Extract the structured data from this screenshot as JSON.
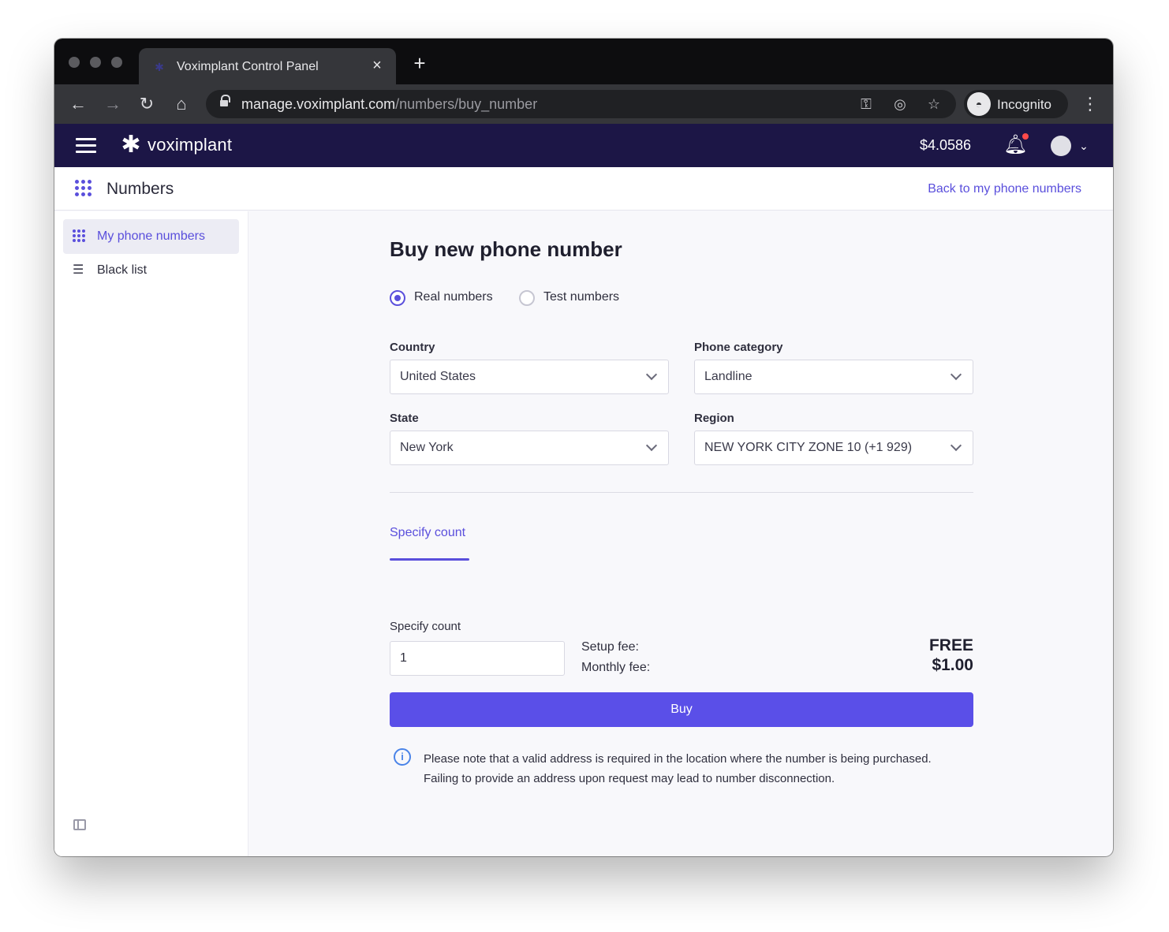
{
  "browser": {
    "tab_title": "Voximplant Control Panel",
    "url_host": "manage.voximplant.com",
    "url_path": "/numbers/buy_number",
    "profile_label": "Incognito"
  },
  "app": {
    "logo_text": "voximplant",
    "balance": "$4.0586"
  },
  "subheader": {
    "title": "Numbers",
    "back_link": "Back to my phone numbers"
  },
  "sidebar": {
    "items": [
      {
        "label": "My phone numbers",
        "active": true
      },
      {
        "label": "Black list",
        "active": false
      }
    ]
  },
  "main": {
    "title": "Buy new phone number",
    "radios": [
      {
        "label": "Real numbers",
        "checked": true
      },
      {
        "label": "Test numbers",
        "checked": false
      }
    ],
    "fields": {
      "country": {
        "label": "Country",
        "value": "United States"
      },
      "phone_category": {
        "label": "Phone category",
        "value": "Landline"
      },
      "state": {
        "label": "State",
        "value": "New York"
      },
      "region": {
        "label": "Region",
        "value": "NEW YORK CITY ZONE 10 (+1 929)"
      }
    },
    "tab_label": "Specify count",
    "count_label": "Specify count",
    "count_value": "1",
    "setup_fee_label": "Setup fee:",
    "setup_fee_value": "FREE",
    "monthly_fee_label": "Monthly fee:",
    "monthly_fee_value": "$1.00",
    "buy_label": "Buy",
    "notice": "Please note that a valid address is required in the location where the number is being purchased. Failing to provide an address upon request may lead to number disconnection."
  },
  "colors": {
    "accent": "#5a4fe8",
    "header_bg": "#1c1646",
    "notification_dot": "#ff4a4a",
    "info": "#4a84e8"
  },
  "icons": [
    "favicon-icon",
    "close-icon",
    "plus-icon",
    "back-icon",
    "forward-icon",
    "reload-icon",
    "home-icon",
    "lock-icon",
    "key-icon",
    "eye-off-icon",
    "star-icon",
    "incognito-icon",
    "more-vert-icon",
    "hamburger-icon",
    "voximplant-logo-icon",
    "bell-icon",
    "avatar",
    "chevron-down-icon",
    "grid-icon",
    "list-icon",
    "sidebar-collapse-icon",
    "info-icon"
  ]
}
